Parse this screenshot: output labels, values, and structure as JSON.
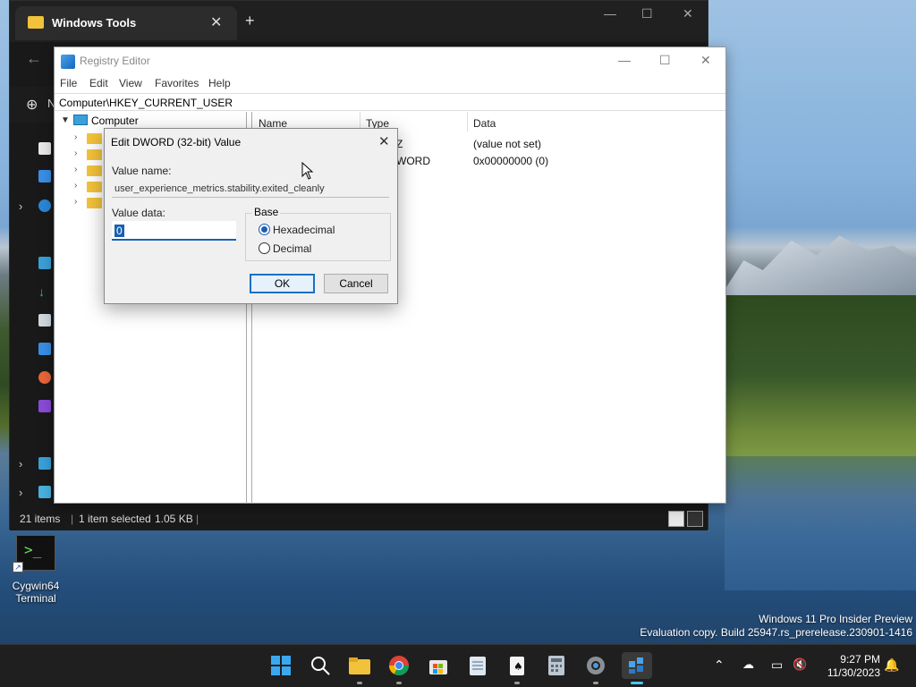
{
  "explorer": {
    "tab_title": "Windows Tools",
    "status_items": "21 items",
    "status_selected": "1 item selected",
    "status_size": "1.05 KB",
    "new_initial": "N"
  },
  "regedit": {
    "title": "Registry Editor",
    "menu": [
      "File",
      "Edit",
      "View",
      "Favorites",
      "Help"
    ],
    "address": "Computer\\HKEY_CURRENT_USER",
    "tree_root": "Computer",
    "columns": [
      "Name",
      "Type",
      "Data"
    ],
    "rows": [
      {
        "type_fragment": "Z",
        "data": "(value not set)"
      },
      {
        "type_fragment": "WORD",
        "data": "0x00000000 (0)"
      }
    ]
  },
  "dialog": {
    "title": "Edit DWORD (32-bit) Value",
    "value_name_label": "Value name:",
    "value_name": "user_experience_metrics.stability.exited_cleanly",
    "value_data_label": "Value data:",
    "value_data": "0",
    "base_label": "Base",
    "base_options": [
      "Hexadecimal",
      "Decimal"
    ],
    "base_selected": "Hexadecimal",
    "ok_label": "OK",
    "cancel_label": "Cancel"
  },
  "desktop": {
    "icon_label_line1": "Cygwin64",
    "icon_label_line2": "Terminal"
  },
  "watermark": {
    "line1": "Windows 11 Pro Insider Preview",
    "line2": "Evaluation copy. Build 25947.rs_prerelease.230901-1416"
  },
  "taskbar": {
    "apps": [
      "start-icon",
      "search-icon",
      "file-explorer-icon",
      "chrome-icon",
      "store-icon",
      "notepad-icon",
      "solitaire-icon",
      "calculator-icon",
      "settings-icon",
      "regedit-icon"
    ],
    "time": "9:27 PM",
    "date": "11/30/2023"
  },
  "colors": {
    "accent": "#1a5fb4",
    "taskbar": "#1f1f1f",
    "explorer_dark": "#191919"
  }
}
